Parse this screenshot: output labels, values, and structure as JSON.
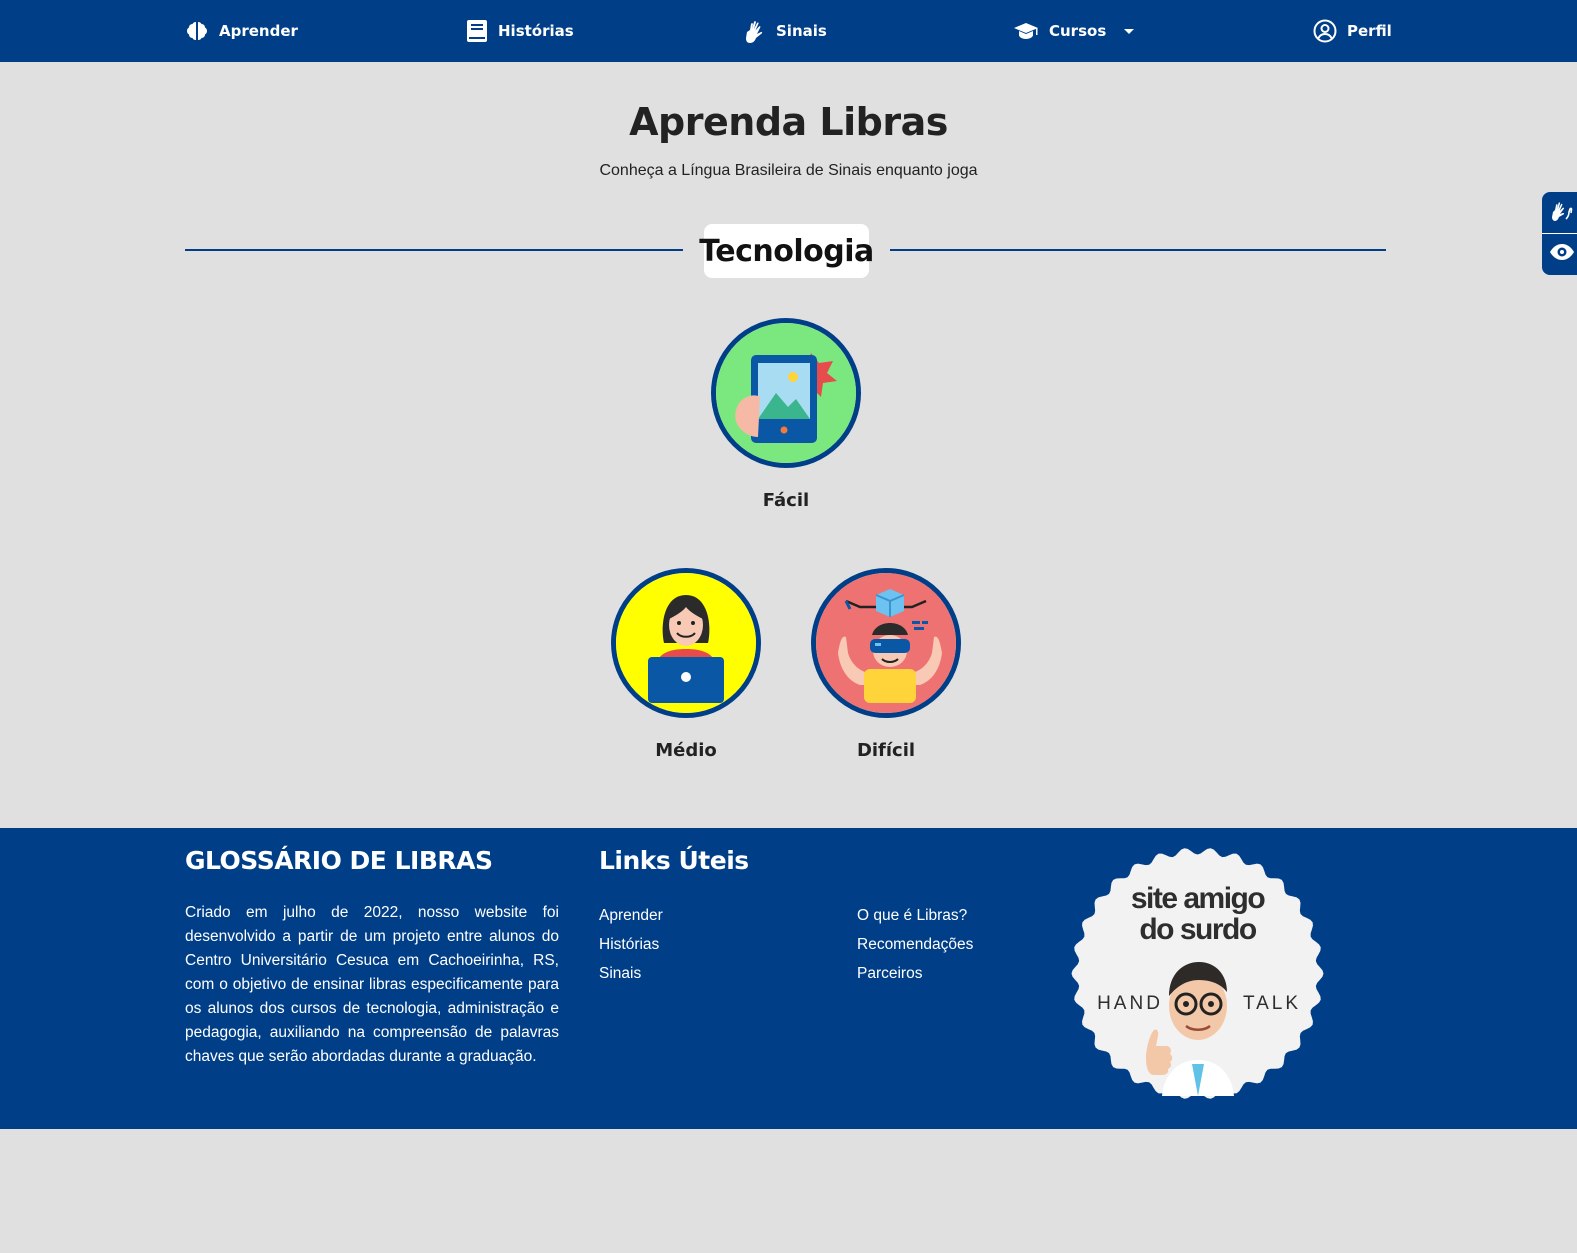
{
  "nav": {
    "aprender": "Aprender",
    "historias": "Histórias",
    "sinais": "Sinais",
    "cursos": "Cursos",
    "perfil": "Perfil"
  },
  "header": {
    "title": "Aprenda Libras",
    "subtitle": "Conheça a Língua Brasileira de Sinais enquanto joga"
  },
  "category": "Tecnologia",
  "levels": [
    {
      "label": "Fácil",
      "color": "#7be87f"
    },
    {
      "label": "Médio",
      "color": "#ffff00"
    },
    {
      "label": "Difícil",
      "color": "#ee7272"
    }
  ],
  "footer": {
    "glossary_title": "GLOSSÁRIO DE LIBRAS",
    "description": "Criado em julho de 2022, nosso website foi desenvolvido a partir de um projeto entre alunos do Centro Universitário Cesuca em Cachoeirinha, RS, com o objetivo de ensinar libras especificamente para os alunos dos cursos de tecnologia, administração e pedagogia, auxiliando na compreensão de palavras chaves que serão abordadas durante a graduação.",
    "links_title": "Links Úteis",
    "links_col1": [
      "Aprender",
      "Histórias",
      "Sinais"
    ],
    "links_col2": [
      "O que é Libras?",
      "Recomendações",
      "Parceiros"
    ],
    "badge": {
      "line1": "site amigo",
      "line2": "do surdo",
      "left": "HAND",
      "right": "TALK"
    }
  },
  "colors": {
    "primary": "#003f88",
    "background": "#e0e0e0"
  }
}
